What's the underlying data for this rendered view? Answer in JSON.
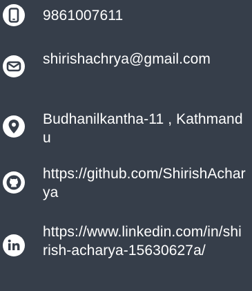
{
  "contacts": {
    "phone": {
      "icon": "phone-icon",
      "text": "9861007611"
    },
    "email": {
      "icon": "mail-icon",
      "text": "shirishachrya@gmail.com"
    },
    "address": {
      "icon": "location-pin-icon",
      "text": "Budhanilkantha-11 , Kathmandu"
    },
    "github": {
      "icon": "github-icon",
      "text": "https://github.com/ShirishAcharya"
    },
    "linkedin": {
      "icon": "linkedin-icon",
      "text": "https://www.linkedin.com/in/shirish-acharya-15630627a/"
    }
  },
  "colors": {
    "background": "#363e4a",
    "icon_bg": "#ffffff",
    "icon_fg": "#363e4a",
    "text": "#ffffff"
  }
}
